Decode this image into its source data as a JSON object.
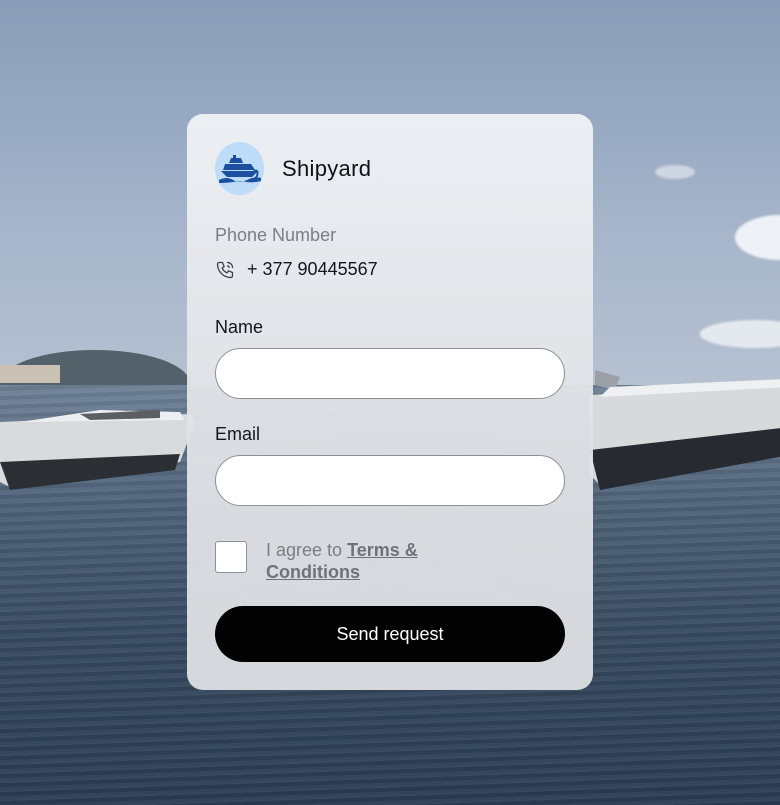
{
  "brand": {
    "name": "Shipyard",
    "logo_icon": "ship-icon"
  },
  "contact": {
    "phone_label": "Phone Number",
    "phone_icon": "phone-icon",
    "phone_value": "+ 377 90445567"
  },
  "form": {
    "name_label": "Name",
    "name_value": "",
    "email_label": "Email",
    "email_value": "",
    "agree_prefix": "I agree to",
    "agree_link": "Terms & Conditions",
    "agree_checked": false,
    "submit_label": "Send request"
  },
  "colors": {
    "button_bg": "#020202",
    "logo_bg": "#bedcf7",
    "logo_ship": "#1d4fa0"
  }
}
